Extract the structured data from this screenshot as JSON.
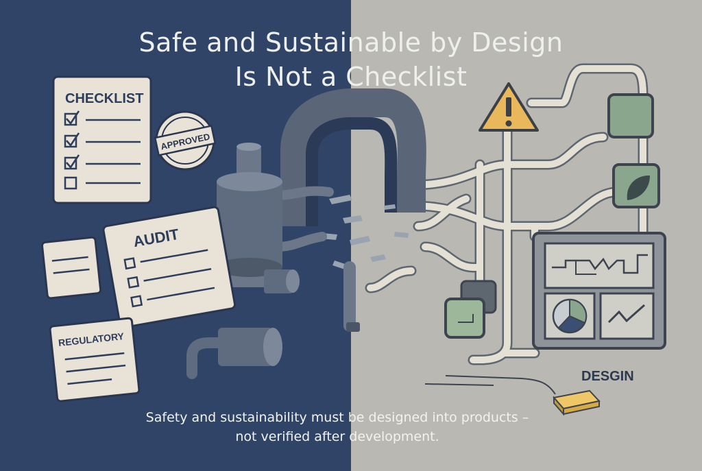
{
  "title": {
    "line1": "Safe and Sustainable by Design",
    "line2": "Is Not a Checklist"
  },
  "caption": {
    "line1": "Safety and sustainability must be designed into products –",
    "line2": "not verified after development."
  },
  "labels": {
    "checklist": "CHECKLIST",
    "approved": "APPROVED",
    "audit": "AUDIT",
    "regulatory": "REGULATORY",
    "design": "DESGIN",
    "warning_glyph": "!"
  },
  "colors": {
    "left_bg": "#2f4466",
    "right_bg": "#b9b8b3",
    "paper": "#e8e3d6",
    "ink": "#2d3d5c",
    "warning": "#e9b85a",
    "module_green": "#8aa68c",
    "block_gold": "#ddb04a"
  },
  "icons": [
    "checkbox-checked-icon",
    "checkbox-empty-icon",
    "warning-icon",
    "leaf-icon",
    "pie-chart-icon",
    "line-chart-icon",
    "waveform-icon"
  ]
}
